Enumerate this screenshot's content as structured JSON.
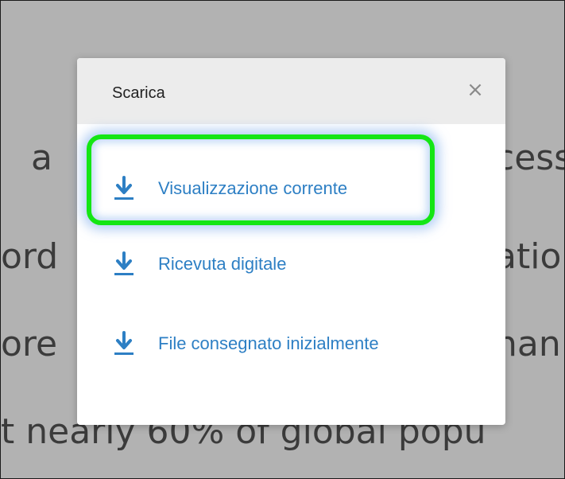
{
  "background_text": {
    "line1_left": "a",
    "line1_right": "cess",
    "line2_left": "ord",
    "line2_right": "atio",
    "line3_left": "ore",
    "line3_right": "han",
    "line4": "t nearly 60% of global popu"
  },
  "dialog": {
    "title": "Scarica",
    "close_label": "×",
    "items": [
      {
        "label": "Visualizzazione corrente",
        "icon": "download-icon",
        "highlighted": true
      },
      {
        "label": "Ricevuta digitale",
        "icon": "download-icon",
        "highlighted": false
      },
      {
        "label": "File consegnato inizialmente",
        "icon": "download-icon",
        "highlighted": false
      }
    ]
  },
  "colors": {
    "link": "#2d7fc4",
    "highlight": "#14e614",
    "header_bg": "#ececec",
    "overlay": "#5f5f5f"
  }
}
